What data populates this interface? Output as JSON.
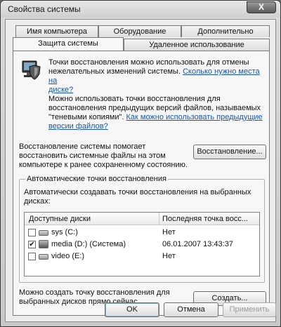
{
  "window": {
    "title": "Свойства системы",
    "close_glyph": "X"
  },
  "tabs": {
    "row1": [
      {
        "label": "Имя компьютера"
      },
      {
        "label": "Оборудование"
      },
      {
        "label": "Дополнительно"
      }
    ],
    "row2": [
      {
        "label": "Защита системы",
        "selected": true
      },
      {
        "label": "Удаленное использование"
      }
    ]
  },
  "intro": {
    "line1": "Точки восстановления можно использовать для отмены",
    "line2": "нежелательных изменений системы.",
    "link1_a": "Сколько нужно места на",
    "link1_b": "диске?",
    "line3": "Можно использовать точки восстановления для",
    "line4": "восстановления предыдущих версий файлов, называемых",
    "line5": "\"теневыми копиями\".",
    "link2_a": "Как можно использовать предыдущие",
    "link2_b": "версии файлов?"
  },
  "restore": {
    "text1": "Восстановление системы помогает",
    "text2": "восстановить системные файлы на этом",
    "text3": "компьютере к ранее сохраненному состоянию.",
    "button_label": "Восстановление..."
  },
  "auto_points": {
    "legend": "Автоматические точки восстановления",
    "desc1": "Автоматически создавать точки восстановления на выбранных",
    "desc2": "дисках:",
    "columns": [
      "Доступные диски",
      "Последняя точка восс..."
    ],
    "drives": [
      {
        "name": "sys (C:)",
        "checked": false,
        "last_point": "Нет"
      },
      {
        "name": "media (D:) (Система)",
        "checked": true,
        "last_point": "06.01.2007 13:43:37"
      },
      {
        "name": "video (E:)",
        "checked": false,
        "last_point": "Нет"
      }
    ]
  },
  "create": {
    "text1": "Можно создать точку восстановления для",
    "text2": "выбранных дисков прямо сейчас.",
    "button_label": "Создать..."
  },
  "footer": {
    "ok_label": "OK",
    "cancel_label": "Отмена",
    "apply_label": "Применить"
  },
  "icons": {
    "protection": "computer-shield-icon",
    "drive": "hard-drive-icon",
    "system_drive": "system-drive-icon",
    "checkmark_glyph": "✔"
  }
}
